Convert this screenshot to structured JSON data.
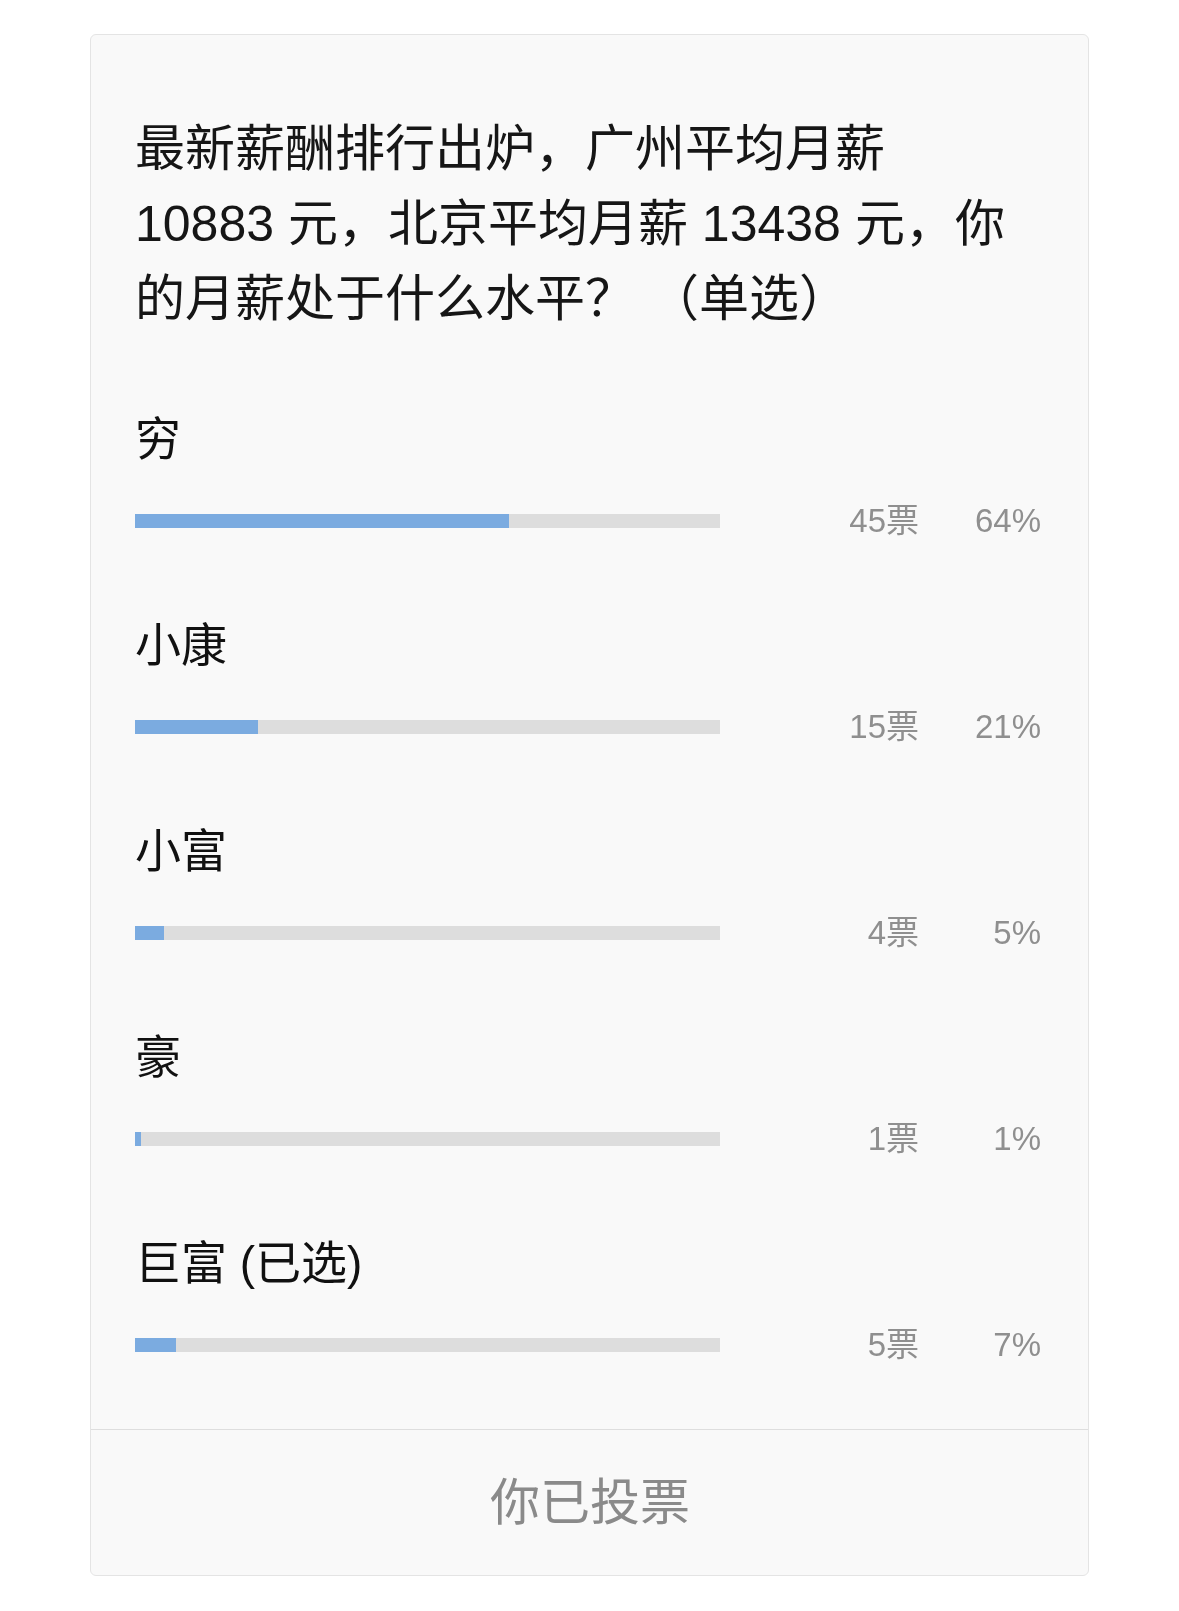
{
  "poll": {
    "question": "最新薪酬排行出炉，广州平均月薪 10883 元，北京平均月薪 13438 元，你的月薪处于什么水平？ （单选）",
    "options": [
      {
        "label": "穷",
        "level": 0.64,
        "votes": "45票",
        "percent": "64%"
      },
      {
        "label": "小康",
        "level": 0.21,
        "votes": "15票",
        "percent": "21%"
      },
      {
        "label": "小富",
        "level": 0.05,
        "votes": "4票",
        "percent": "5%"
      },
      {
        "label": "豪",
        "level": 0.01,
        "votes": "1票",
        "percent": "1%"
      },
      {
        "label": "巨富 (已选)",
        "level": 0.07,
        "votes": "5票",
        "percent": "7%"
      }
    ],
    "footer_button": {
      "label": "你已投票",
      "disabled": true
    }
  }
}
